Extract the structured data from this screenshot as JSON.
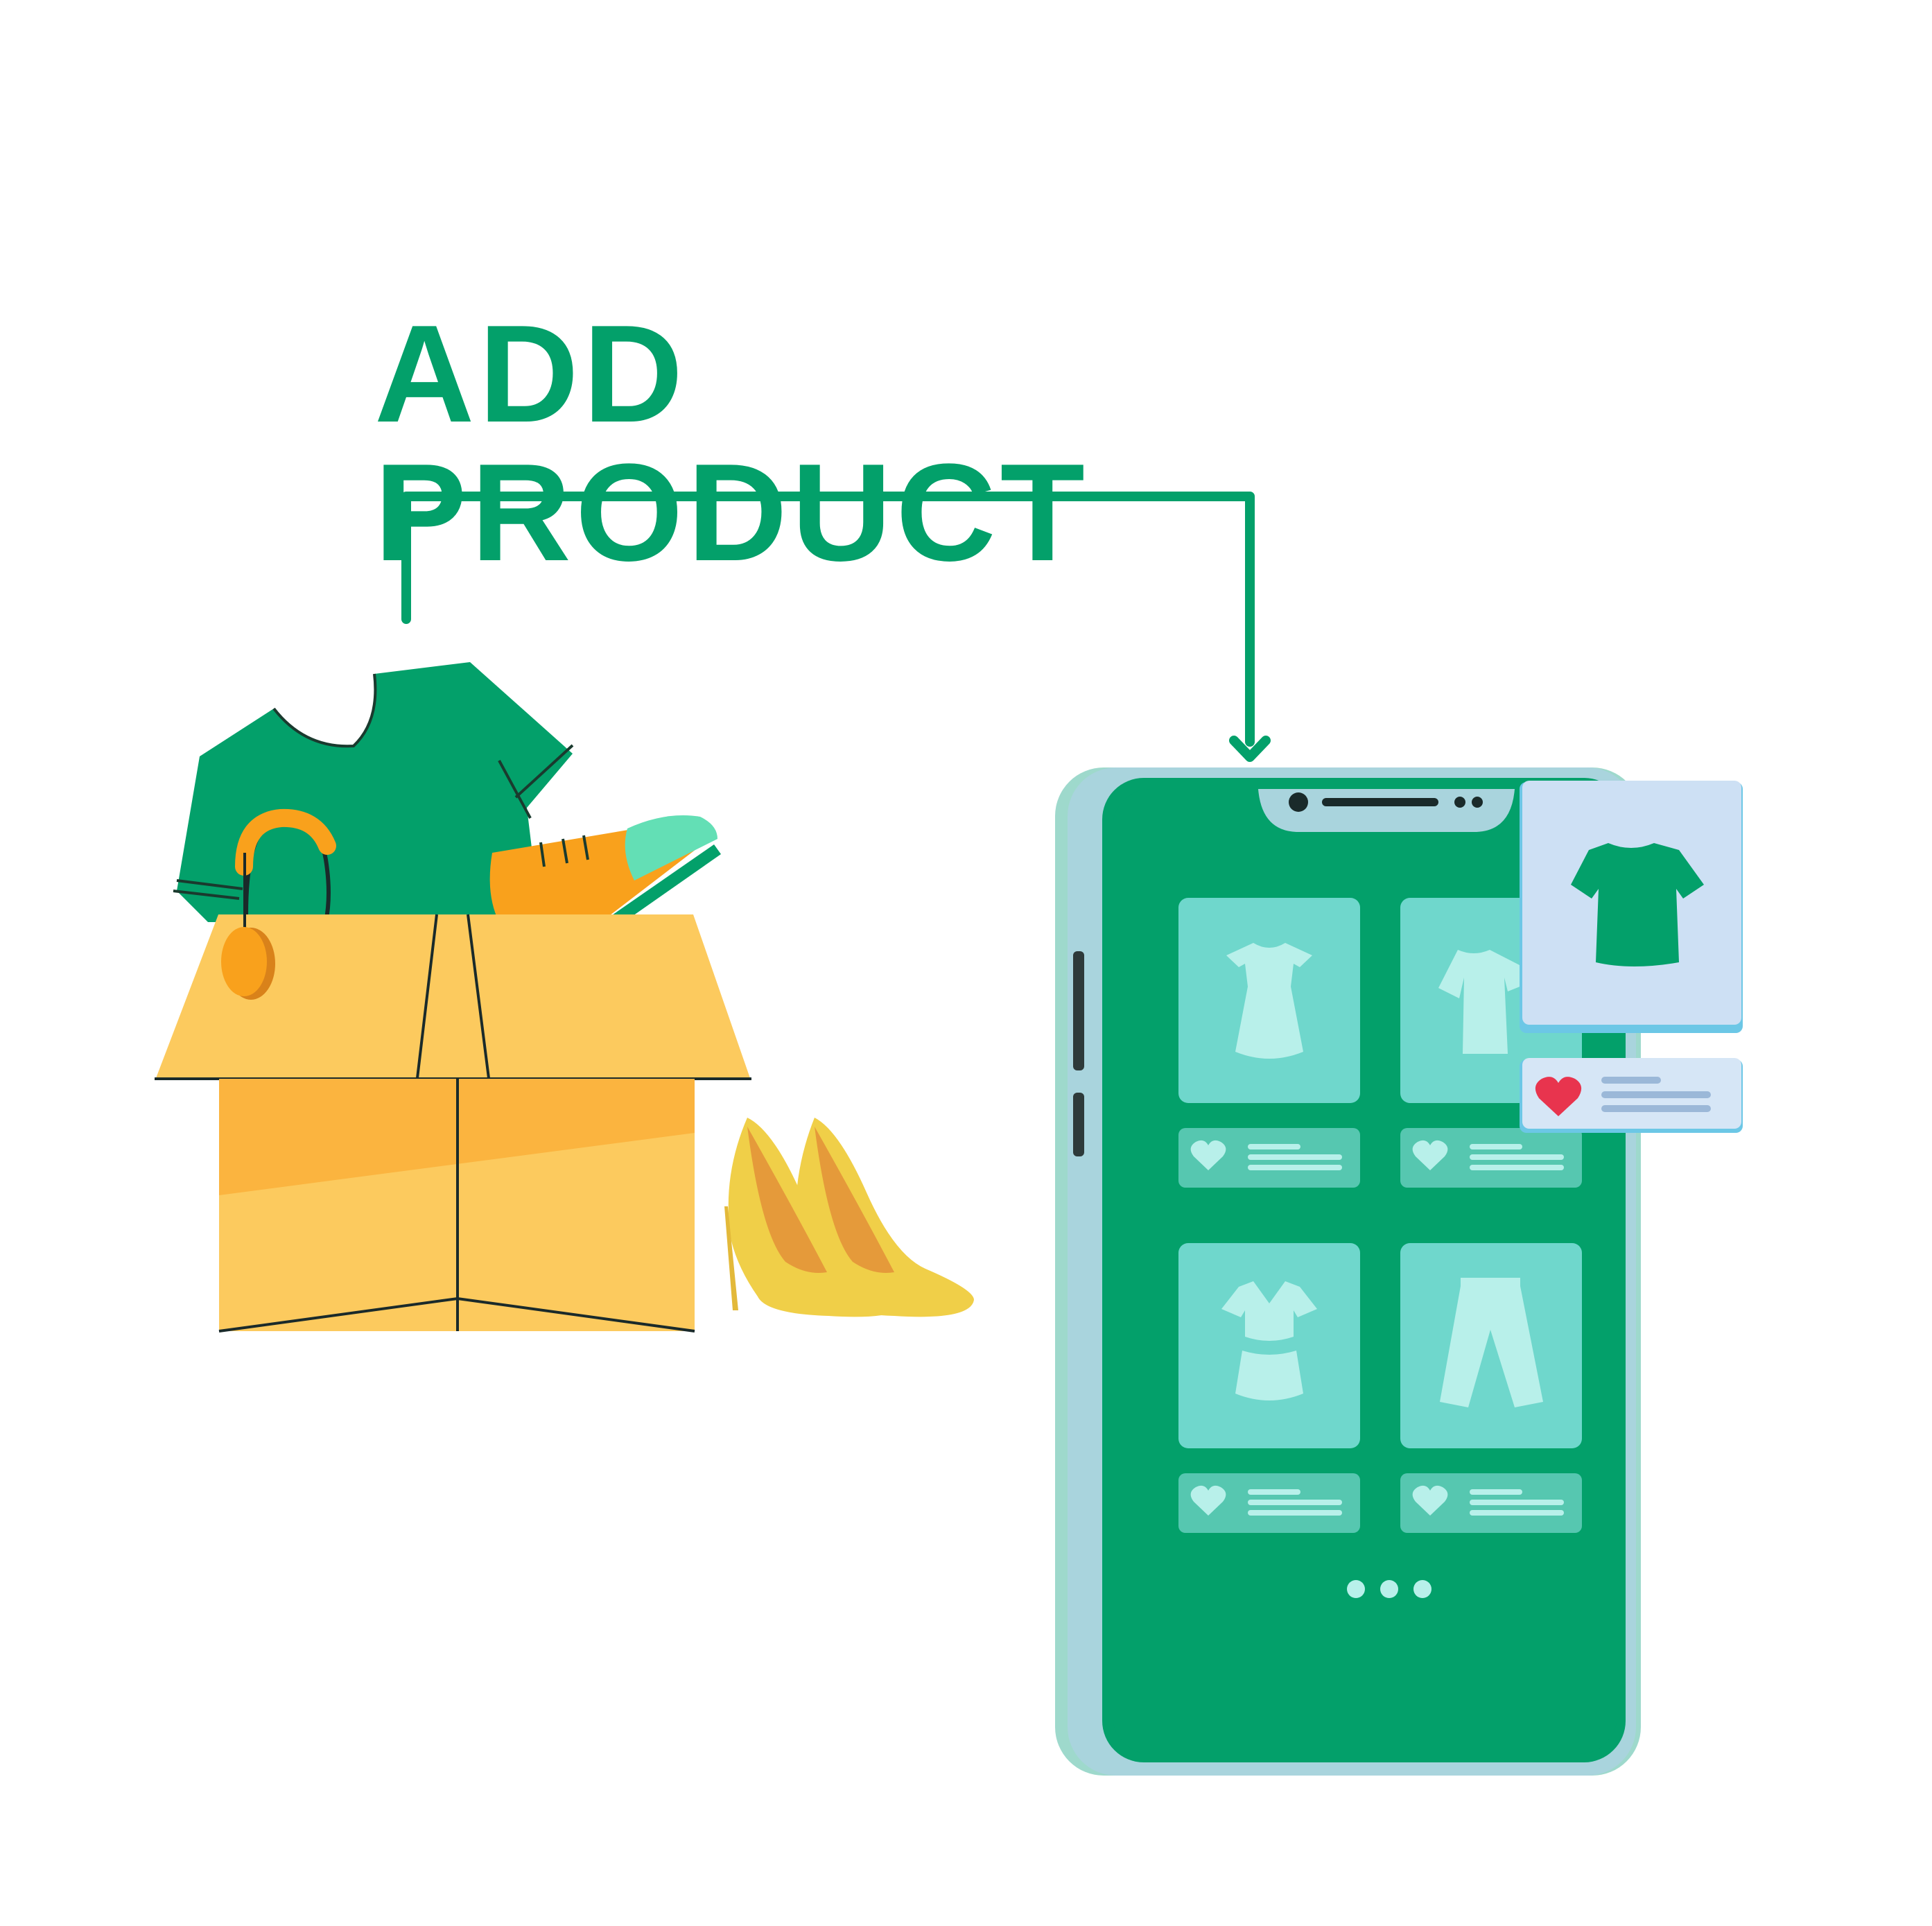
{
  "title": {
    "text": "ADD PRODUCT"
  },
  "colors": {
    "brand_green": "#03a06a",
    "box_light": "#fcca5e",
    "box_dark": "#fbb43f",
    "card_teal": "#6fd7cc",
    "glyph_light": "#b8f0ea",
    "heart_red": "#e8344e",
    "phone_frame": "#a9d4dd"
  },
  "icons": [
    "tshirt-icon",
    "heart-icon",
    "dress-icon",
    "shirt-icon",
    "pants-icon",
    "skirt-set-icon",
    "more-dots-icon"
  ]
}
